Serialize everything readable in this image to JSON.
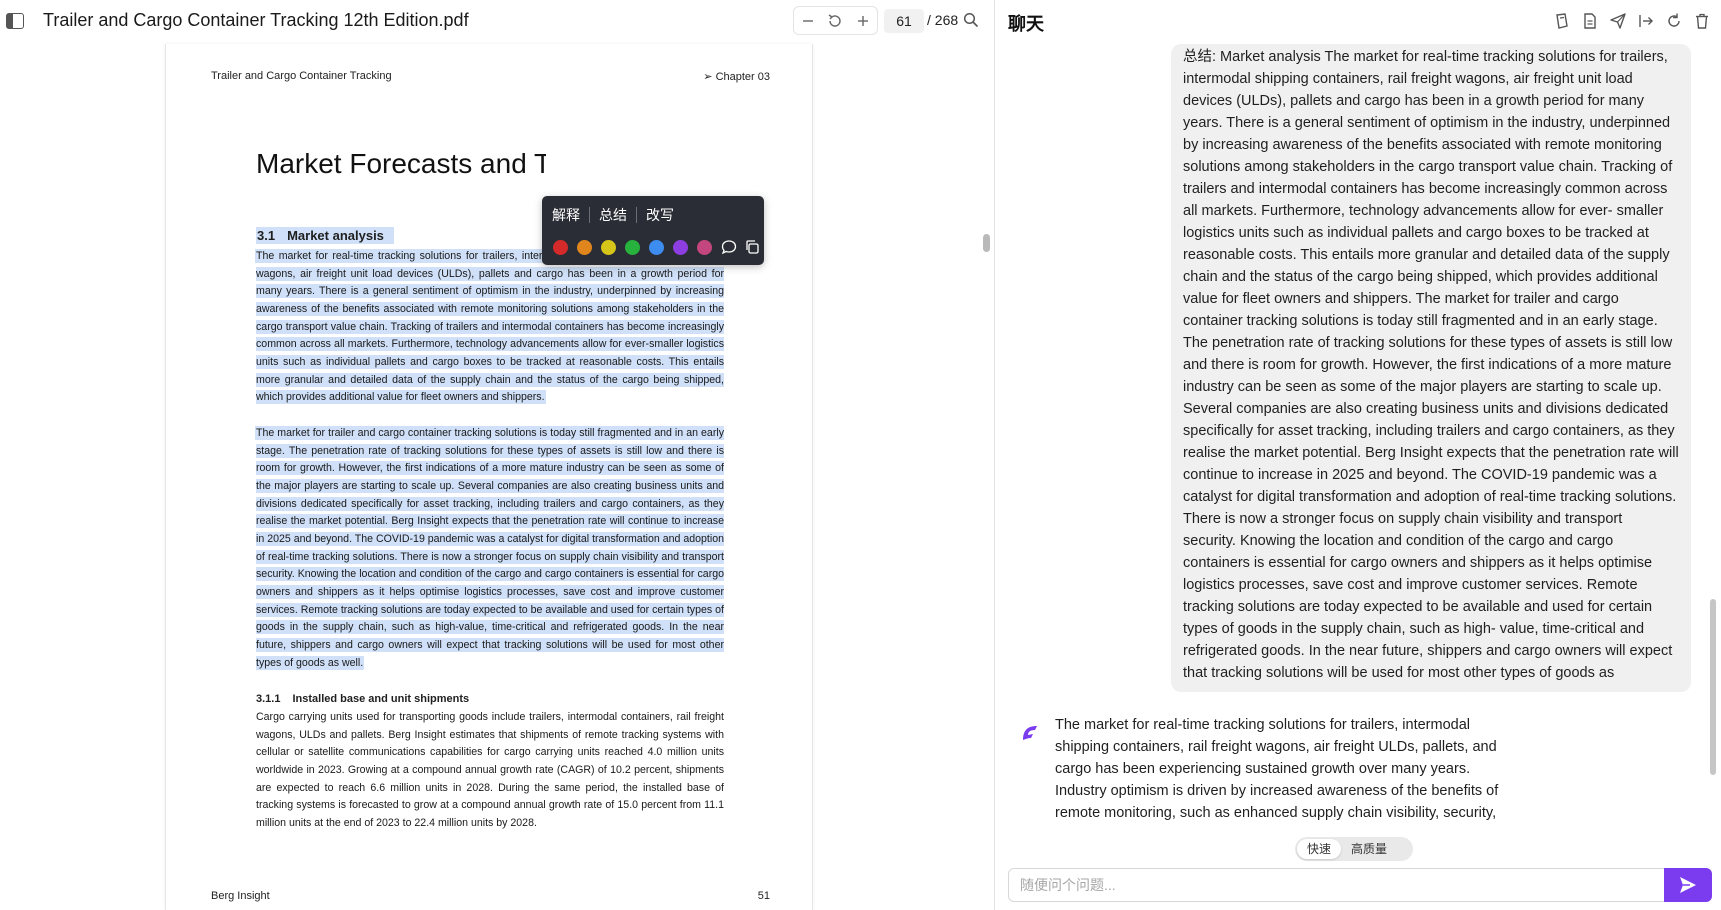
{
  "pdf": {
    "title": "Trailer and Cargo Container Tracking 12th Edition.pdf",
    "current_page": "61",
    "total_pages": "/ 268",
    "page": {
      "header_left": "Trailer and Cargo Container Tracking",
      "header_right": "➢ Chapter 03",
      "heading": "Market Forecasts and Trends",
      "section_number": "3.1",
      "section_title": "Market analysis",
      "para1": "The market for real-time tracking solutions for trailers, intermodal shipping containers, rail freight wagons, air freight unit load devices (ULDs), pallets and cargo has been in a growth period for many years. There is a general sentiment of optimism in the industry, underpinned by increasing awareness of the benefits associated with remote monitoring solutions among stakeholders in the cargo transport value chain. Tracking of trailers and intermodal containers has become increasingly common across all markets. Furthermore, technology advancements allow for ever-smaller logistics units such as individual pallets and cargo boxes to be tracked at reasonable costs. This entails more granular and detailed data of the supply chain and the status of the cargo being shipped, which provides additional value for fleet owners and shippers.",
      "para2": "The market for trailer and cargo container tracking solutions is today still fragmented and in an early stage. The penetration rate of tracking solutions for these types of assets is still low and there is room for growth. However, the first indications of a more mature industry can be seen as some of the major players are starting to scale up. Several companies are also creating business units and divisions dedicated specifically for asset tracking, including trailers and cargo containers, as they realise the market potential. Berg Insight expects that the penetration rate will continue to increase in 2025 and beyond. The COVID-19 pandemic was a catalyst for digital transformation and adoption of real-time tracking solutions. There is now a stronger focus on supply chain visibility and transport security. Knowing the location and condition of the cargo and cargo containers is essential for cargo owners and shippers as it helps optimise logistics processes, save cost and improve customer services. Remote tracking solutions are today expected to be available and used for certain types of goods in the supply chain, such as high-value, time-critical and refrigerated goods. In the near future, shippers and cargo owners will expect that tracking solutions will be used for most other types of goods as well.",
      "subsection_number": "3.1.1",
      "subsection_title": "Installed base and unit shipments",
      "para3": "Cargo carrying units used for transporting goods include trailers, intermodal containers, rail freight wagons, ULDs and pallets. Berg Insight estimates that shipments of remote tracking systems with cellular or satellite communications capabilities for cargo carrying units reached 4.0 million units worldwide in 2023. Growing at a compound annual growth rate (CAGR) of 10.2 percent, shipments are expected to reach 6.6 million units in 2028. During the same period, the installed base of tracking systems is forecasted to grow at a compound annual growth rate of 15.0 percent from 11.1 million units at the end of 2023 to 22.4 million units by 2028.",
      "footer_left": "Berg Insight",
      "footer_right": "51"
    },
    "selection_popup": {
      "actions": [
        "解释",
        "总结",
        "改写"
      ],
      "colors": [
        "#d42a2a",
        "#e0861c",
        "#d6c61a",
        "#27b23e",
        "#3d8cf0",
        "#8c3ee0",
        "#c4467e"
      ]
    }
  },
  "chat": {
    "title": "聊天",
    "user_message": "总结: Market analysis The market for real-time tracking solutions for trailers, intermodal shipping containers, rail freight wagons, air freight unit load devices (ULDs), pallets and cargo has been in a growth period for many years. There is a general sentiment of optimism in the industry, underpinned by increasing awareness of the benefits associated with remote monitoring solutions among stakeholders in the cargo transport value chain. Tracking of trailers and intermodal containers has become increasingly common across all markets. Furthermore, technology advancements allow for ever- smaller logistics units such as individual pallets and cargo boxes to be tracked at reasonable costs. This entails more granular and detailed data of the supply chain and the status of the cargo being shipped, which provides additional value for fleet owners and shippers. The market for trailer and cargo container tracking solutions is today still fragmented and in an early stage. The penetration rate of tracking solutions for these types of assets is still low and there is room for growth. However, the first indications of a more mature industry can be seen as some of the major players are starting to scale up. Several companies are also creating business units and divisions dedicated specifically for asset tracking, including trailers and cargo containers, as they realise the market potential. Berg Insight expects that the penetration rate will continue to increase in 2025 and beyond. The COVID-19 pandemic was a catalyst for digital transformation and adoption of real-time tracking solutions. There is now a stronger focus on supply chain visibility and transport security. Knowing the location and condition of the cargo and cargo containers is essential for cargo owners and shippers as it helps optimise logistics processes, save cost and improve customer services. Remote tracking solutions are today expected to be available and used for certain types of goods in the supply chain, such as high- value, time-critical and refrigerated goods. In the near future, shippers and cargo owners will expect that tracking solutions will be used for most other types of goods as",
    "bot_message": "The market for real-time tracking solutions for trailers, intermodal shipping containers, rail freight wagons, air freight ULDs, pallets, and cargo has been experiencing sustained growth over many years. Industry optimism is driven by increased awareness of the benefits of remote monitoring, such as enhanced supply chain visibility, security,",
    "mode_fast": "快速",
    "mode_quality": "高质量",
    "input_placeholder": "随便问个问题...",
    "accent_color": "#7b3cf0"
  }
}
